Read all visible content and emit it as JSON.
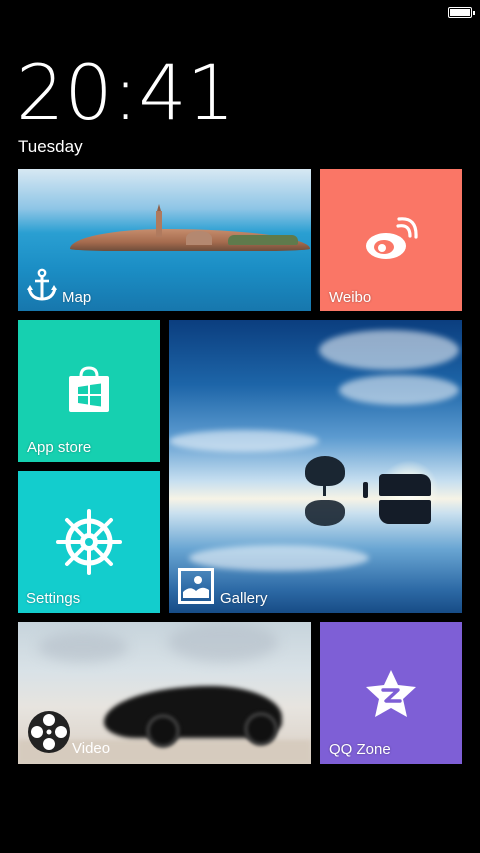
{
  "status": {
    "battery_level": 1.0
  },
  "lockscreen": {
    "time": "20:41",
    "day": "Tuesday"
  },
  "tiles": {
    "map": {
      "label": "Map",
      "icon": "anchor-icon"
    },
    "weibo": {
      "label": "Weibo",
      "icon": "weibo-icon",
      "color": "#fa7666"
    },
    "app_store": {
      "label": "App store",
      "icon": "store-bag-icon",
      "color": "#16d0b0"
    },
    "gallery": {
      "label": "Gallery",
      "icon": "picture-icon"
    },
    "settings": {
      "label": "Settings",
      "icon": "ship-wheel-icon",
      "color": "#13cdcd"
    },
    "video": {
      "label": "Video",
      "icon": "film-reel-icon"
    },
    "qq_zone": {
      "label": "QQ Zone",
      "icon": "qq-star-icon",
      "color": "#7e5fd6"
    }
  }
}
